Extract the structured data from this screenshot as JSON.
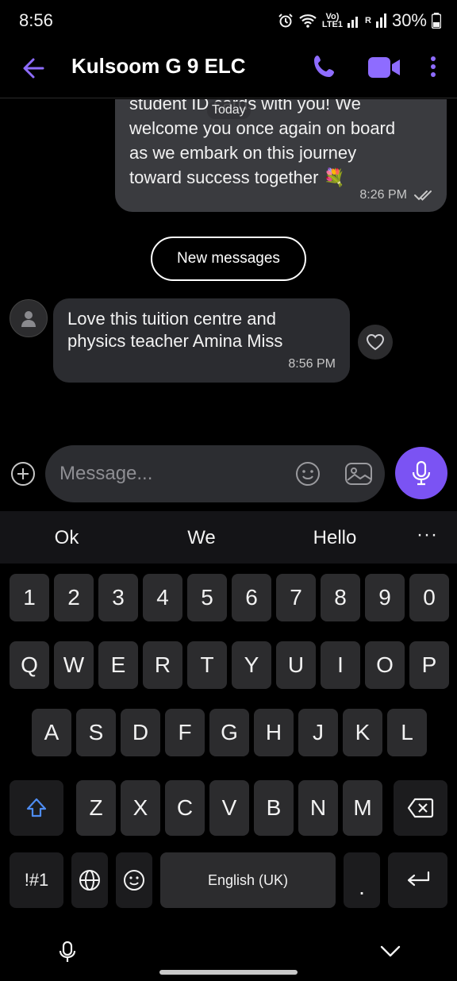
{
  "status_bar": {
    "time": "8:56",
    "volte": "Vo)",
    "lte": "LTE1",
    "roaming": "R",
    "battery": "30%"
  },
  "header": {
    "title": "Kulsoom G 9 ELC"
  },
  "chat": {
    "date_label": "Today",
    "outgoing": {
      "text": "student ID cards with you! We\nwelcome you once again on board\nas we embark on this journey\ntoward success together 💐",
      "time": "8:26 PM"
    },
    "new_messages_label": "New messages",
    "incoming": {
      "text": "Love this tuition centre and physics teacher Amina Miss",
      "time": "8:56 PM"
    }
  },
  "composer": {
    "placeholder": "Message..."
  },
  "keyboard": {
    "suggestions": [
      "Ok",
      "We",
      "Hello"
    ],
    "suggestion_more": "···",
    "row_numbers": [
      "1",
      "2",
      "3",
      "4",
      "5",
      "6",
      "7",
      "8",
      "9",
      "0"
    ],
    "row_top": [
      "Q",
      "W",
      "E",
      "R",
      "T",
      "Y",
      "U",
      "I",
      "O",
      "P"
    ],
    "row_mid": [
      "A",
      "S",
      "D",
      "F",
      "G",
      "H",
      "J",
      "K",
      "L"
    ],
    "row_bottom": [
      "Z",
      "X",
      "C",
      "V",
      "B",
      "N",
      "M"
    ],
    "symbols_key": "!#1",
    "space_key": "English (UK)",
    "period_key": "."
  },
  "colors": {
    "accent": "#7b53f3",
    "header_icons": "#8e6cff",
    "shift_icon": "#4e8cf2"
  }
}
